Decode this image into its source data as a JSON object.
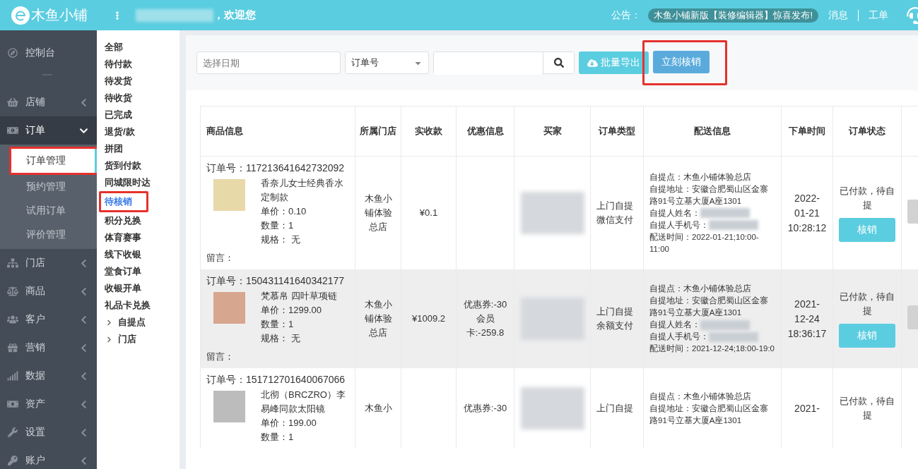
{
  "header": {
    "logo_text": "木鱼小铺",
    "welcome": "，欢迎您",
    "notice_label": "公告：",
    "notice": "木鱼小铺新版【装修编辑器】惊喜发布!",
    "links": [
      "消息",
      "工单"
    ]
  },
  "sidebar": {
    "items": [
      {
        "kind": "link",
        "label": "控制台",
        "expanded": false
      },
      {
        "kind": "group",
        "label": "店铺",
        "expanded": false
      },
      {
        "kind": "group",
        "label": "订单",
        "expanded": true,
        "children": [
          {
            "label": "订单管理",
            "selected": true,
            "highlighted": true
          },
          {
            "label": "预约管理",
            "selected": false,
            "highlighted": false
          },
          {
            "label": "试用订单",
            "selected": false,
            "highlighted": false
          },
          {
            "label": "评价管理",
            "selected": false,
            "highlighted": false
          }
        ]
      },
      {
        "kind": "group",
        "label": "门店",
        "expanded": false
      },
      {
        "kind": "group",
        "label": "商品",
        "expanded": false
      },
      {
        "kind": "group",
        "label": "客户",
        "expanded": false
      },
      {
        "kind": "group",
        "label": "营销",
        "expanded": false
      },
      {
        "kind": "group",
        "label": "数据",
        "expanded": false
      },
      {
        "kind": "group",
        "label": "资产",
        "expanded": false
      },
      {
        "kind": "group",
        "label": "设置",
        "expanded": false
      },
      {
        "kind": "group",
        "label": "账户",
        "expanded": false
      }
    ]
  },
  "filters": [
    {
      "kind": "status",
      "label": "全部",
      "selected": false,
      "highlighted": false
    },
    {
      "kind": "status",
      "label": "待付款",
      "selected": false,
      "highlighted": false
    },
    {
      "kind": "status",
      "label": "待发货",
      "selected": false,
      "highlighted": false
    },
    {
      "kind": "status",
      "label": "待收货",
      "selected": false,
      "highlighted": false
    },
    {
      "kind": "status",
      "label": "已完成",
      "selected": false,
      "highlighted": false
    },
    {
      "kind": "status",
      "label": "退货/款",
      "selected": false,
      "highlighted": false
    },
    {
      "kind": "status",
      "label": "拼团",
      "selected": false,
      "highlighted": false
    },
    {
      "kind": "status",
      "label": "货到付款",
      "selected": false,
      "highlighted": false
    },
    {
      "kind": "status",
      "label": "同城限时达",
      "selected": false,
      "highlighted": false
    },
    {
      "kind": "status",
      "label": "待核销",
      "selected": true,
      "highlighted": true
    },
    {
      "kind": "status",
      "label": "积分兑换",
      "selected": false,
      "highlighted": false
    },
    {
      "kind": "status",
      "label": "体育赛事",
      "selected": false,
      "highlighted": false
    },
    {
      "kind": "status",
      "label": "线下收银",
      "selected": false,
      "highlighted": false
    },
    {
      "kind": "status",
      "label": "堂食订单",
      "selected": false,
      "highlighted": false
    },
    {
      "kind": "status",
      "label": "收银开单",
      "selected": false,
      "highlighted": false
    },
    {
      "kind": "status",
      "label": "礼品卡兑换",
      "selected": false,
      "highlighted": false
    },
    {
      "kind": "tree",
      "label": "自提点",
      "selected": false,
      "highlighted": false
    },
    {
      "kind": "tree",
      "label": "门店",
      "selected": false,
      "highlighted": false
    }
  ],
  "toolbar": {
    "date": {
      "placeholder": "选择日期"
    },
    "search_type": "订单号",
    "export_button": "批量导出",
    "verify_button": {
      "label": "立刻核销",
      "highlighted": true
    }
  },
  "table": {
    "columns": [
      "商品信息",
      "所属门店",
      "实收款",
      "优惠信息",
      "买家",
      "订单类型",
      "配送信息",
      "下单时间",
      "订单状态"
    ],
    "rows": [
      {
        "order_no_label": "订单号：",
        "order_no": "117213641642732092",
        "product": "香奈儿女士经典香水定制款",
        "details": [
          "单价：0.10",
          "数量：1",
          "规格：  无"
        ],
        "message": "留言：",
        "store": "木鱼小铺体验总店",
        "amount": "¥0.1",
        "discounts": [],
        "order_type": [
          "上门自提",
          "微信支付"
        ],
        "delivery": [
          {
            "text": "自提点：木鱼小铺体验总店",
            "blurred": false
          },
          {
            "text": "自提地址：安徽合肥蜀山区金寨路91号立基大厦A座1301",
            "blurred": false
          },
          {
            "text": "自提人姓名：",
            "blurred": true
          },
          {
            "text": "自提人手机号：",
            "blurred": true
          },
          {
            "text": "配送时间：2022-01-21;10:00-11:00",
            "blurred": false
          }
        ],
        "time": "2022-01-21 10:28:12",
        "status": "已付款，待自提",
        "action": "核销",
        "shaded": false
      },
      {
        "order_no_label": "订单号：",
        "order_no": "150431141640342177",
        "product": "梵慕帛 四叶草项链",
        "details": [
          "单价：1299.00",
          "数量：1",
          "规格：  无"
        ],
        "message": "留言：",
        "store": "木鱼小铺体验总店",
        "amount": "¥1009.2",
        "discounts": [
          "优惠券:-30",
          "会员卡:-259.8"
        ],
        "order_type": [
          "上门自提",
          "余额支付"
        ],
        "delivery": [
          {
            "text": "自提点：木鱼小铺体验总店",
            "blurred": false
          },
          {
            "text": "自提地址：安徽合肥蜀山区金寨路91号立基大厦A座1301",
            "blurred": false
          },
          {
            "text": "自提人姓名：",
            "blurred": true
          },
          {
            "text": "自提人手机号：",
            "blurred": true
          },
          {
            "text": "配送时间：2021-12-24;18:00-19:0",
            "blurred": false
          }
        ],
        "time": "2021-12-24 18:36:17",
        "status": "已付款，待自提",
        "action": "核销",
        "shaded": true
      },
      {
        "order_no_label": "订单号：",
        "order_no": "151712701640067066",
        "product": "北彻（BRCZRO）李易峰同款太阳镜",
        "details": [
          "单价：199.00",
          "数量：1"
        ],
        "store": "木鱼小",
        "discounts": [
          "优惠券:-30"
        ],
        "order_type": [
          "上门自提"
        ],
        "delivery": [
          {
            "text": "自提点：木鱼小铺体验总店",
            "blurred": false
          },
          {
            "text": "自提地址：安徽合肥蜀山区金寨路91号立基大厦A座1301",
            "blurred": false
          }
        ],
        "time": "2021-",
        "status": "已付款，待自提",
        "shaded": false
      }
    ]
  }
}
